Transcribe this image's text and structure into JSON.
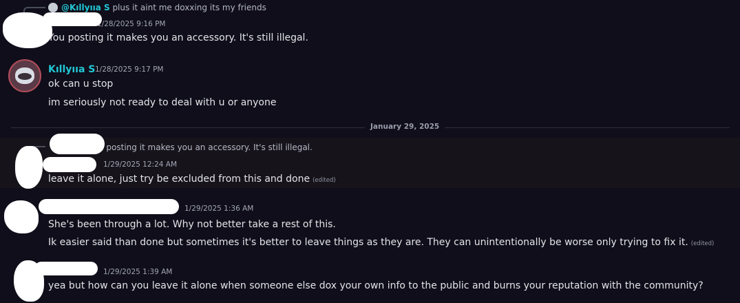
{
  "messages": [
    {
      "reply": {
        "mention": "@Kıllyııa S",
        "text": "plus it aint me doxxing its my friends"
      },
      "timestamp": "1/28/2025 9:16 PM",
      "lines": [
        "You posting it makes you an accessory. It's still illegal."
      ]
    },
    {
      "author": "Kıllyııa S",
      "timestamp": "1/28/2025 9:17 PM",
      "lines": [
        "ok can u stop",
        "im seriously not ready to deal with u or anyone"
      ]
    },
    {
      "reply": {
        "text": "u posting it makes you an accessory. It's still illegal."
      },
      "timestamp": "1/29/2025 12:24 AM",
      "lines": [
        "leave it alone, just try be excluded from this and done"
      ],
      "edited": "(edited)"
    },
    {
      "timestamp": "1/29/2025 1:36 AM",
      "lines": [
        "She's been through a lot. Why not better take a rest of this.",
        "Ik easier said than done but sometimes it's better to leave things as they are. They can unintentionally be worse only trying to fix it."
      ],
      "edited": "(edited)"
    },
    {
      "timestamp": "1/29/2025 1:39 AM",
      "lines": [
        "yea but how can you leave it alone when someone else dox your own info to the public and burns your reputation with the community?"
      ]
    }
  ],
  "date_divider": "January 29, 2025",
  "colors": {
    "background": "#0f0e1a",
    "author": "#22c7d6",
    "highlight": "#16131b"
  }
}
